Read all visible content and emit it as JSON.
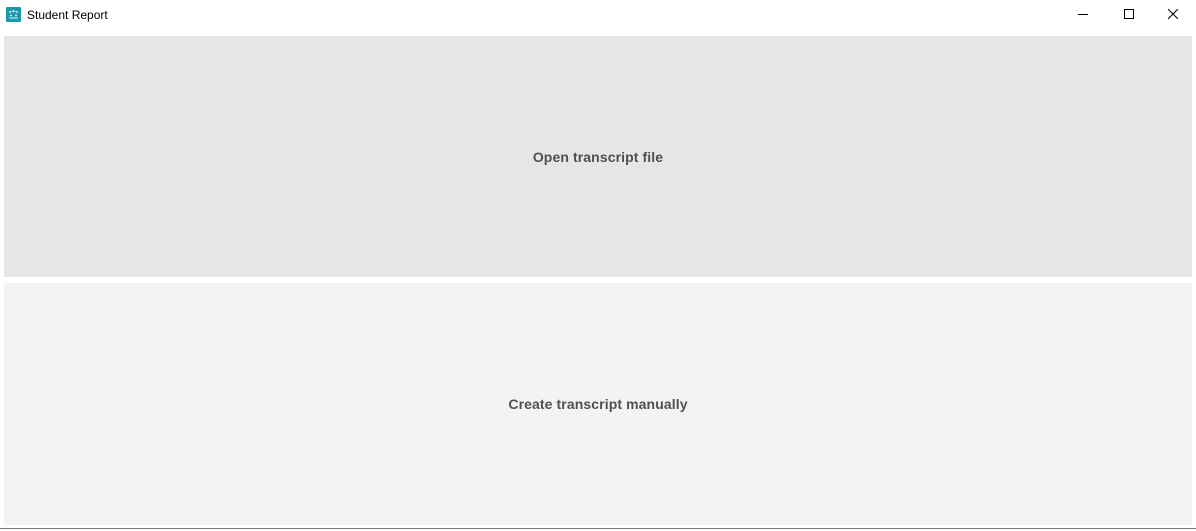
{
  "window": {
    "title": "Student Report",
    "icon": "student-report-app-icon",
    "accent_color": "#1a9aa8"
  },
  "caption_buttons": {
    "minimize_icon": "minimize-icon",
    "maximize_icon": "maximize-icon",
    "close_icon": "close-icon"
  },
  "main": {
    "open_label": "Open transcript file",
    "create_label": "Create transcript manually",
    "open_bg": "#e6e6e6",
    "create_bg": "#f3f3f3"
  }
}
